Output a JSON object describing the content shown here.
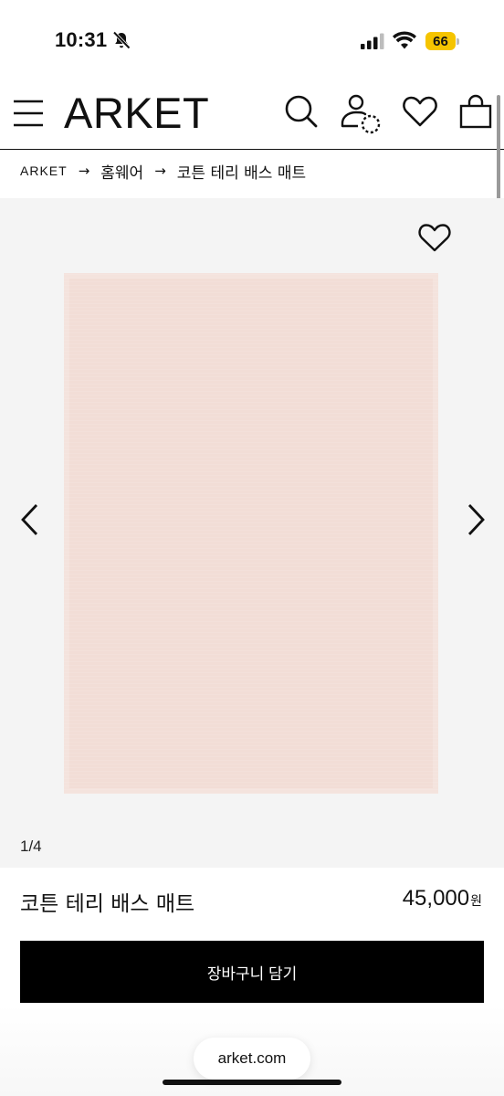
{
  "status_bar": {
    "time": "10:31",
    "battery": "66",
    "icons": [
      "bell-slash-icon",
      "cellular-signal-icon",
      "wifi-icon",
      "battery-icon"
    ]
  },
  "header": {
    "logo": "ARKET",
    "icons": [
      "menu-icon",
      "search-icon",
      "account-icon",
      "wishlist-icon",
      "shopping-bag-icon"
    ]
  },
  "breadcrumb": {
    "items": [
      "ARKET",
      "홈웨어",
      "코튼 테리 배스 매트"
    ],
    "separator": "→"
  },
  "gallery": {
    "counter": "1/4",
    "image_color": "#f2ddd6"
  },
  "product": {
    "name": "코튼 테리 배스 매트",
    "price": "45,000",
    "currency": "원"
  },
  "cart_button": {
    "label": "장바구니 담기"
  },
  "browser": {
    "url": "arket.com"
  }
}
